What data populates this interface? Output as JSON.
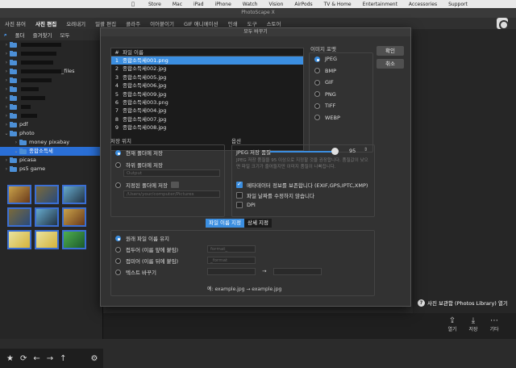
{
  "macbar": {
    "menu": [
      "Store",
      "Mac",
      "iPad",
      "iPhone",
      "Watch",
      "Vision",
      "AirPods",
      "TV & Home",
      "Entertainment",
      "Accessories",
      "Support"
    ]
  },
  "app": {
    "title": "PhotoScape X",
    "tabs": [
      "사진 뷰어",
      "사진 편집",
      "오려내기",
      "일괄 편집",
      "콜라주",
      "이어붙이기",
      "GIF 애니메이션",
      "인쇄",
      "도구",
      "스토어"
    ],
    "active_tab": "사진 편집"
  },
  "left": {
    "tabs": [
      "폴더",
      "즐겨찾기",
      "모두"
    ],
    "tree": [
      {
        "label": "",
        "redact": 50
      },
      {
        "label": "",
        "redact": 44
      },
      {
        "label": "",
        "redact": 40
      },
      {
        "label": "_files",
        "redact": 50
      },
      {
        "label": "",
        "redact": 38
      },
      {
        "label": "",
        "redact": 22
      },
      {
        "label": "",
        "redact": 30
      },
      {
        "label": "",
        "redact": 12
      },
      {
        "label": "",
        "redact": 20
      },
      {
        "label": "pdf",
        "redact": 0
      },
      {
        "label": "photo",
        "redact": 0
      },
      {
        "label": "money pixabay",
        "redact": 0
      },
      {
        "label": "종합소득세",
        "redact": 0,
        "selected": true
      },
      {
        "label": "picasa",
        "redact": 0
      },
      {
        "label": "ps5 game",
        "redact": 0
      }
    ],
    "bottom_icons": [
      "star-icon",
      "refresh-icon",
      "back-icon",
      "forward-icon",
      "up-icon",
      "gear-icon"
    ]
  },
  "dialog": {
    "title": "모두 바꾸기",
    "file_table": {
      "header": "파일 이름",
      "rows": [
        {
          "num": "1",
          "name": "종합소득세001.png",
          "selected": true
        },
        {
          "num": "2",
          "name": "종합소득세002.jpg"
        },
        {
          "num": "3",
          "name": "종합소득세005.jpg"
        },
        {
          "num": "4",
          "name": "종합소득세006.jpg"
        },
        {
          "num": "5",
          "name": "종합소득세009.jpg"
        },
        {
          "num": "6",
          "name": "종합소득세003.png"
        },
        {
          "num": "7",
          "name": "종합소득세004.jpg"
        },
        {
          "num": "8",
          "name": "종합소득세007.jpg"
        },
        {
          "num": "9",
          "name": "종합소득세008.jpg"
        }
      ]
    },
    "format_label": "이미지 포맷",
    "formats": [
      "JPEG",
      "BMP",
      "GIF",
      "PNG",
      "TIFF",
      "WEBP"
    ],
    "selected_format": "JPEG",
    "ok_label": "확인",
    "cancel_label": "취소",
    "save_location_label": "저장 위치",
    "save_locations": [
      "현재 폴더에 저장",
      "하위 폴더에 저장",
      "지정된 폴더에 저장"
    ],
    "subfolder_placeholder": "Output",
    "folder_placeholder": "/Users/your/computer/Pictures",
    "options_label": "옵션",
    "jpeg_quality_label": "JPEG 저장 품질",
    "jpeg_quality": "95",
    "quality_note": "JPEG 저장 품질을 95 이상으로 지정할 것을 권장합니다. 품질값이 낮으면 파일 크기가 줄어들지만 이미지 품질이 나빠집니다.",
    "option_checks": [
      {
        "label": "메타데이터 정보를 보존합니다 (EXIF,GPS,IPTC,XMP)",
        "on": true
      },
      {
        "label": "파일 날짜를 수정하지 않습니다",
        "on": false
      },
      {
        "label": "DPI",
        "on": false
      }
    ],
    "name_tabs": [
      "파일 이름 지정",
      "상세 지정"
    ],
    "name_modes": [
      "원래 파일 이름 유지",
      "접두어 (이름 앞에 붙임)",
      "접미어 (이름 뒤에 붙임)",
      "텍스트 바꾸기"
    ],
    "prefix_placeholder": "format_",
    "suffix_placeholder": "_format",
    "arrow": "→",
    "example": "예: example.jpg → example.jpg"
  },
  "right": {
    "library_note": "사진 보관함 (Photos Library) 열기",
    "tools": [
      {
        "label": "열기",
        "icon": "open-icon"
      },
      {
        "label": "저장",
        "icon": "save-icon"
      },
      {
        "label": "기타",
        "icon": "more-icon"
      }
    ]
  }
}
